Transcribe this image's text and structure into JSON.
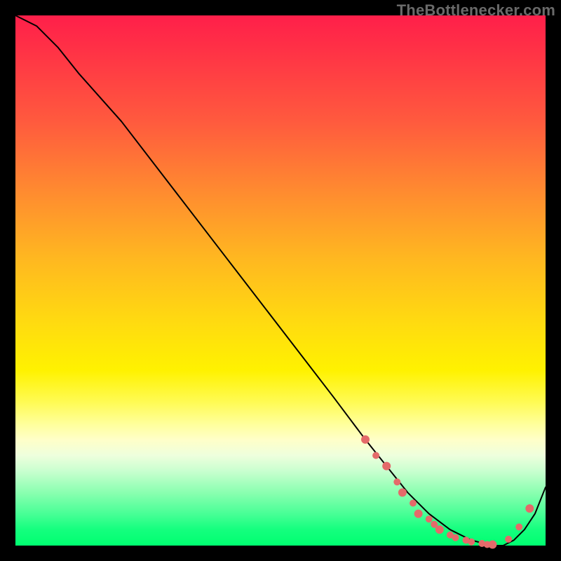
{
  "watermark": "TheBottlenecker.com",
  "colors": {
    "curve": "#000000",
    "dots": "#e46a6a",
    "gradient_top": "#ff1f4a",
    "gradient_bottom": "#00ff70",
    "background": "#000000"
  },
  "chart_data": {
    "type": "line",
    "title": "",
    "xlabel": "",
    "ylabel": "",
    "xlim": [
      0,
      100
    ],
    "ylim": [
      0,
      100
    ],
    "series": [
      {
        "name": "curve",
        "x": [
          0,
          4,
          8,
          12,
          20,
          30,
          40,
          50,
          60,
          66,
          70,
          74,
          78,
          82,
          86,
          90,
          92,
          94,
          96,
          98,
          100
        ],
        "y": [
          100,
          98,
          94,
          89,
          80,
          67,
          54,
          41,
          28,
          20,
          15,
          10,
          6,
          3,
          1,
          0,
          0,
          1,
          3,
          6,
          11
        ]
      }
    ],
    "markers": {
      "name": "highlight-dots",
      "x": [
        66,
        68,
        70,
        72,
        73,
        75,
        76,
        78,
        79,
        80,
        82,
        83,
        85,
        86,
        88,
        89,
        90,
        93,
        95,
        97
      ],
      "y": [
        20,
        17,
        15,
        12,
        10,
        8,
        6,
        5,
        4,
        3,
        2,
        1.5,
        1,
        0.7,
        0.4,
        0.2,
        0.2,
        1.2,
        3.5,
        7
      ],
      "r": [
        6,
        5,
        6,
        5,
        6,
        5,
        6,
        5,
        5,
        6,
        5,
        5,
        5,
        5,
        5,
        5,
        6,
        5,
        5,
        6
      ]
    }
  }
}
